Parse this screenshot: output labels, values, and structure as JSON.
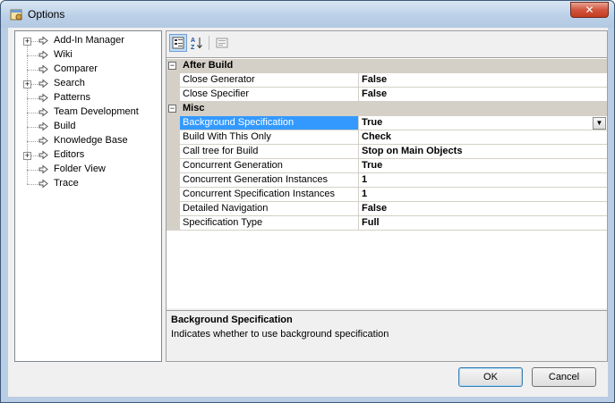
{
  "window": {
    "title": "Options"
  },
  "tree": {
    "items": [
      {
        "label": "Add-In Manager",
        "expandable": true
      },
      {
        "label": "Wiki",
        "expandable": false
      },
      {
        "label": "Comparer",
        "expandable": false
      },
      {
        "label": "Search",
        "expandable": true
      },
      {
        "label": "Patterns",
        "expandable": false
      },
      {
        "label": "Team Development",
        "expandable": false
      },
      {
        "label": "Build",
        "expandable": false
      },
      {
        "label": "Knowledge Base",
        "expandable": false
      },
      {
        "label": "Editors",
        "expandable": true
      },
      {
        "label": "Folder View",
        "expandable": false
      },
      {
        "label": "Trace",
        "expandable": false
      }
    ]
  },
  "toolbar": {
    "categorized_icon": "categorized-icon",
    "alphabetical_icon": "alphabetical-icon",
    "alphabetical_label": "A↓Z",
    "property_pages_icon": "property-pages-icon"
  },
  "grid": {
    "categories": [
      {
        "name": "After Build",
        "properties": [
          {
            "name": "Close Generator",
            "value": "False"
          },
          {
            "name": "Close Specifier",
            "value": "False"
          }
        ]
      },
      {
        "name": "Misc",
        "properties": [
          {
            "name": "Background Specification",
            "value": "True",
            "selected": true
          },
          {
            "name": "Build With This Only",
            "value": "Check"
          },
          {
            "name": "Call tree for Build",
            "value": "Stop on Main Objects"
          },
          {
            "name": "Concurrent Generation",
            "value": "True"
          },
          {
            "name": "Concurrent Generation Instances",
            "value": "1"
          },
          {
            "name": "Concurrent Specification Instances",
            "value": "1"
          },
          {
            "name": "Detailed Navigation",
            "value": "False"
          },
          {
            "name": "Specification Type",
            "value": "Full"
          }
        ]
      }
    ]
  },
  "description": {
    "title": "Background Specification",
    "text": "Indicates whether to use background specification"
  },
  "buttons": {
    "ok": "OK",
    "cancel": "Cancel"
  },
  "colors": {
    "selection": "#3399ff",
    "category_bg": "#d4d0c8"
  }
}
